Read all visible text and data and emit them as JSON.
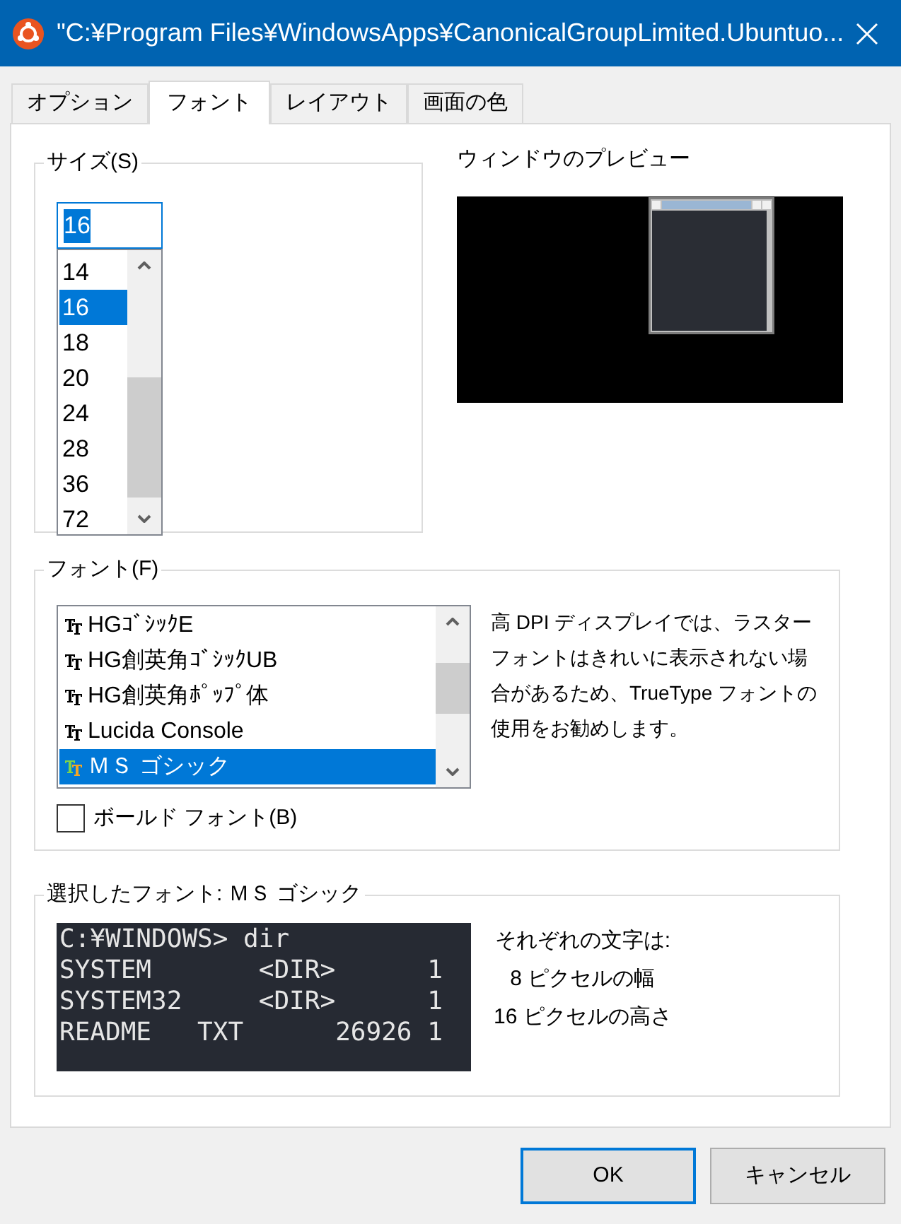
{
  "window": {
    "title": "\"C:¥Program Files¥WindowsApps¥CanonicalGroupLimited.Ubuntuo..."
  },
  "tabs": [
    {
      "label": "オプション",
      "selected": false
    },
    {
      "label": "フォント",
      "selected": true
    },
    {
      "label": "レイアウト",
      "selected": false
    },
    {
      "label": "画面の色",
      "selected": false
    }
  ],
  "size_group": {
    "label": "サイズ(S)",
    "value": "16",
    "items": [
      {
        "label": "14",
        "selected": false
      },
      {
        "label": "16",
        "selected": true
      },
      {
        "label": "18",
        "selected": false
      },
      {
        "label": "20",
        "selected": false
      },
      {
        "label": "24",
        "selected": false
      },
      {
        "label": "28",
        "selected": false
      },
      {
        "label": "36",
        "selected": false
      },
      {
        "label": "72",
        "selected": false
      }
    ]
  },
  "preview": {
    "label": "ウィンドウのプレビュー"
  },
  "font_group": {
    "label": "フォント(F)",
    "items": [
      {
        "label": "HGｺﾞｼｯｸE",
        "selected": false
      },
      {
        "label": "HG創英角ｺﾞｼｯｸUB",
        "selected": false
      },
      {
        "label": "HG創英角ﾎﾟｯﾌﾟ体",
        "selected": false
      },
      {
        "label": "Lucida Console",
        "selected": false
      },
      {
        "label": "ＭＳ ゴシック",
        "selected": true
      }
    ],
    "note": "高 DPI ディスプレイでは、ラスターフォントはきれいに表示されない場合があるため、TrueType フォントの使用をお勧めします。",
    "bold_checkbox": {
      "label": "ボールド フォント(B)",
      "checked": false
    }
  },
  "selected_font": {
    "label": "選択したフォント: ＭＳ ゴシック",
    "sample_lines": [
      "C:¥WINDOWS> dir",
      "SYSTEM       <DIR>      1",
      "SYSTEM32     <DIR>      1",
      "README   TXT      26926 1"
    ],
    "info": [
      "それぞれの文字は:",
      "8 ピクセルの幅",
      "16 ピクセルの高さ"
    ]
  },
  "buttons": [
    {
      "label": "OK",
      "default": true
    },
    {
      "label": "キャンセル",
      "default": false
    }
  ]
}
